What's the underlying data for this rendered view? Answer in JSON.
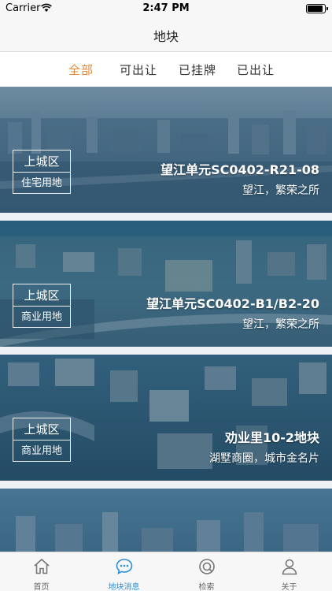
{
  "status_bar": {
    "carrier": "Carrier",
    "time": "2:47 PM"
  },
  "nav": {
    "title": "地块"
  },
  "filters": [
    {
      "label": "全部",
      "active": true
    },
    {
      "label": "可出让",
      "active": false
    },
    {
      "label": "已挂牌",
      "active": false
    },
    {
      "label": "已出让",
      "active": false
    }
  ],
  "cards": [
    {
      "district": "上城区",
      "usage": "住宅用地",
      "title": "望江单元SC0402-R21-08",
      "subtitle": "望江，繁荣之所"
    },
    {
      "district": "上城区",
      "usage": "商业用地",
      "title": "望江单元SC0402-B1/B2-20",
      "subtitle": "望江，繁荣之所"
    },
    {
      "district": "上城区",
      "usage": "商业用地",
      "title": "劝业里10-2地块",
      "subtitle": "湖墅商圈，城市金名片"
    },
    {
      "district": "",
      "usage": "",
      "title": "",
      "subtitle": ""
    }
  ],
  "tabs": [
    {
      "label": "首页",
      "icon": "home-icon",
      "active": false
    },
    {
      "label": "地块消息",
      "icon": "chat-bubble-icon",
      "active": true
    },
    {
      "label": "检索",
      "icon": "search-icon",
      "active": false
    },
    {
      "label": "关于",
      "icon": "user-icon",
      "active": false
    }
  ],
  "colors": {
    "accent_active_filter": "#e08a3a",
    "accent_active_tab": "#2a8fd6",
    "card_tint": "#3f6f91"
  }
}
